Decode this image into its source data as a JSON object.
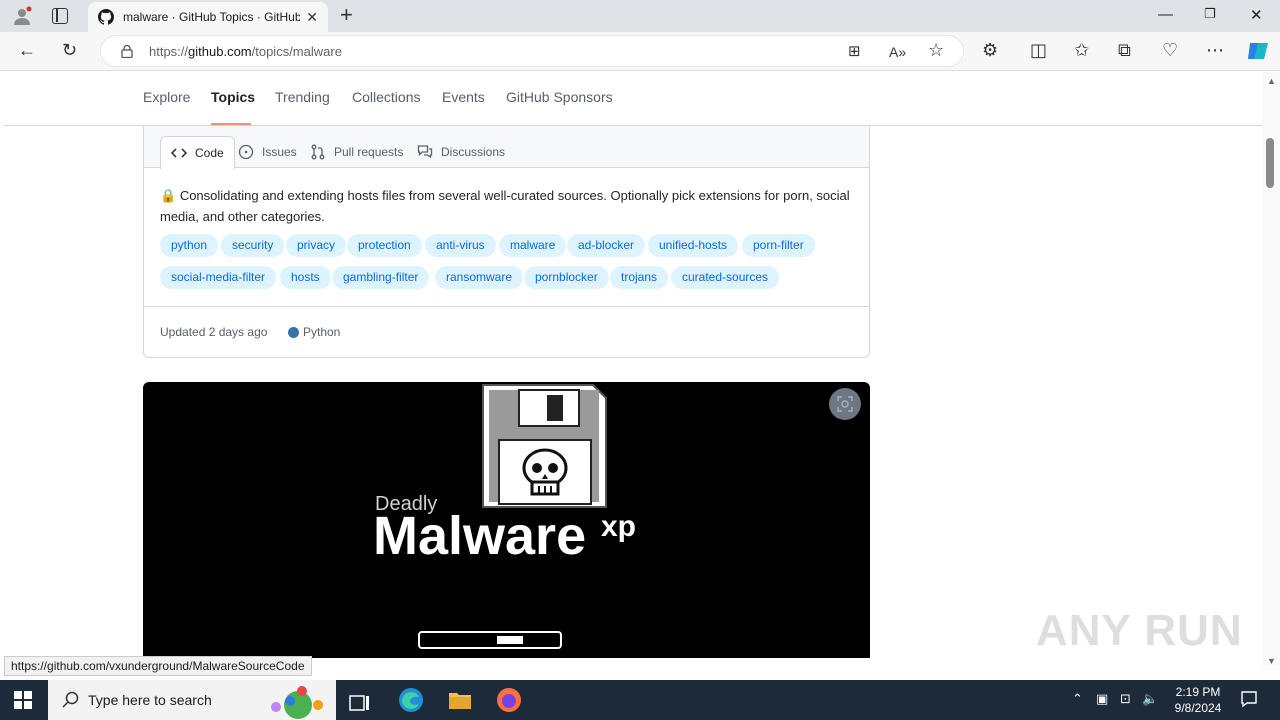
{
  "browser": {
    "tab_title": "malware · GitHub Topics · GitHub",
    "url_prefix": "https://",
    "url_host": "github.com",
    "url_path": "/topics/malware"
  },
  "github_nav": {
    "items": [
      "Explore",
      "Topics",
      "Trending",
      "Collections",
      "Events",
      "GitHub Sponsors"
    ],
    "active": "Topics"
  },
  "repo_card": {
    "tabs": [
      "Code",
      "Issues",
      "Pull requests",
      "Discussions"
    ],
    "description": "Consolidating and extending hosts files from several well-curated sources. Optionally pick extensions for porn, social media, and other categories.",
    "description_emoji": "🔒",
    "topics": [
      "python",
      "security",
      "privacy",
      "protection",
      "anti-virus",
      "malware",
      "ad-blocker",
      "unified-hosts",
      "porn-filter",
      "social-media-filter",
      "hosts",
      "gambling-filter",
      "ransomware",
      "pornblocker",
      "trojans",
      "curated-sources"
    ],
    "updated": "Updated 2 days ago",
    "language": "Python",
    "language_color": "#3572a5"
  },
  "image_card": {
    "small_text": "Deadly",
    "big_text": "Malware",
    "suffix": "xp"
  },
  "status_bar": {
    "link": "https://github.com/vxunderground/MalwareSourceCode"
  },
  "watermark": "ANY RUN",
  "taskbar": {
    "search_placeholder": "Type here to search",
    "time": "2:19 PM",
    "date": "9/8/2024"
  }
}
